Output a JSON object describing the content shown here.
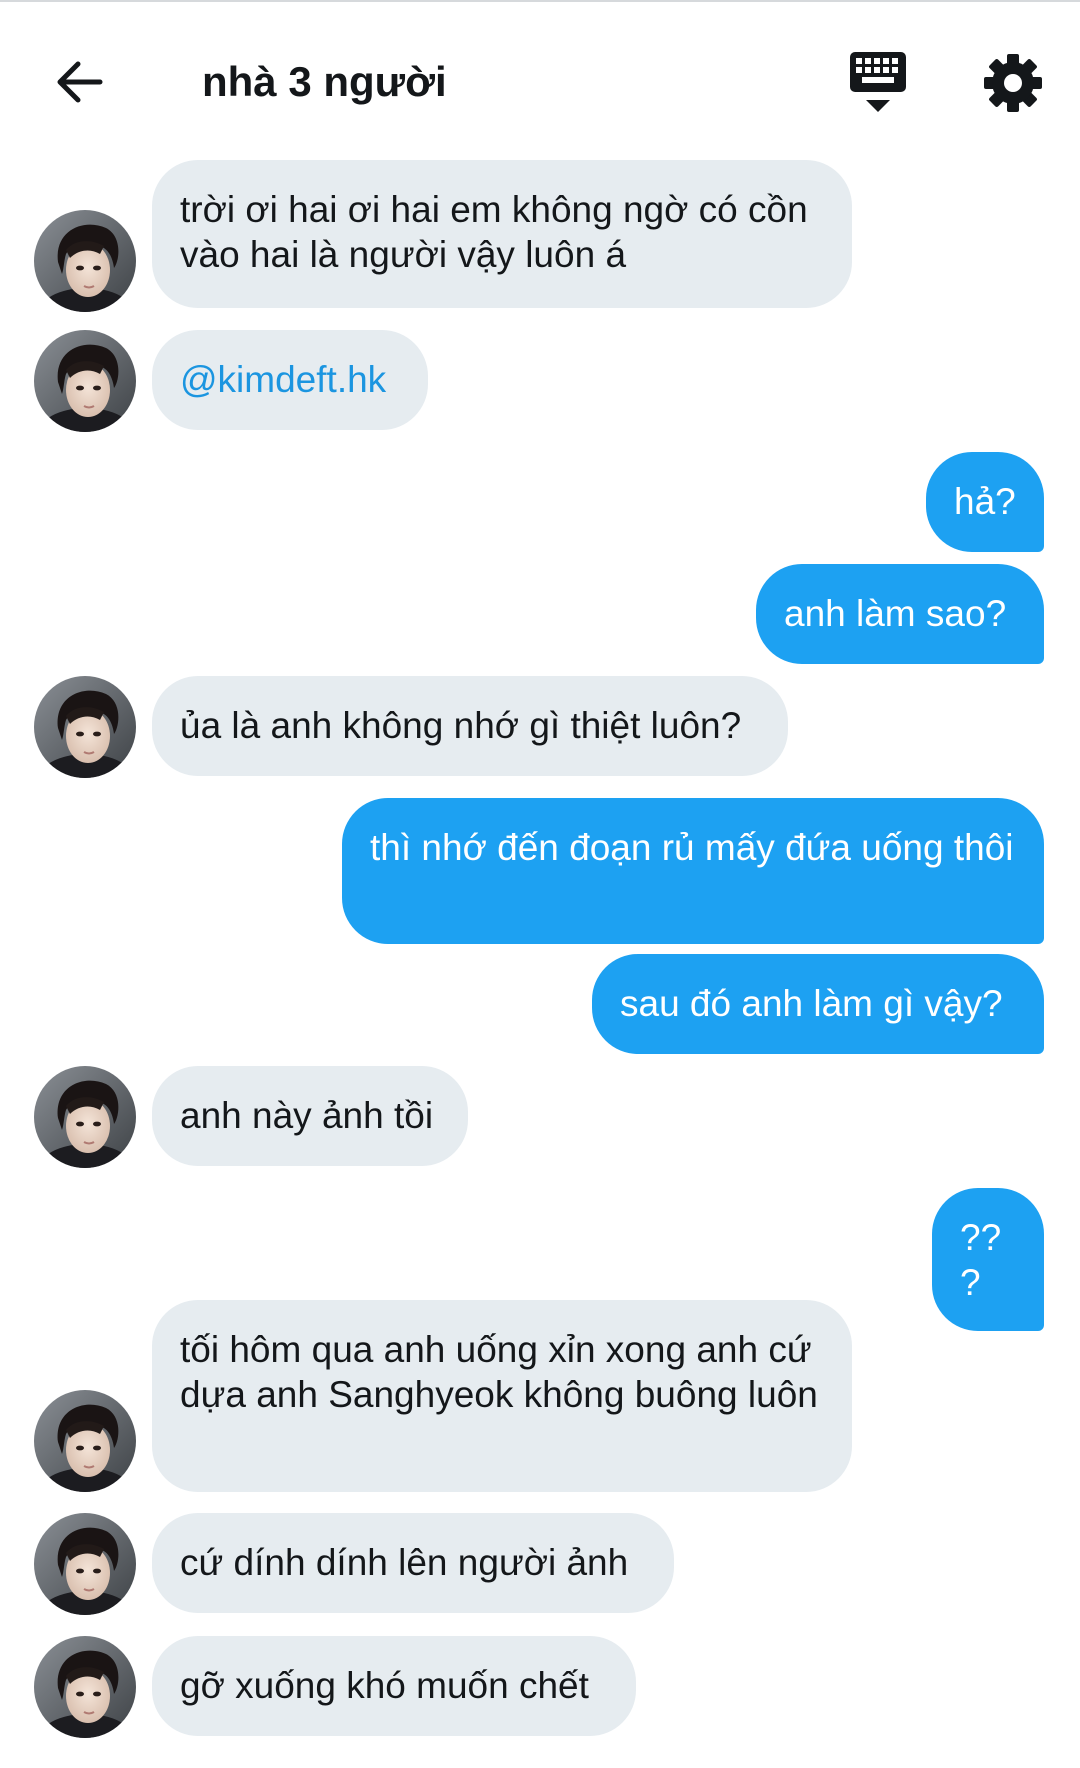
{
  "header": {
    "title": "nhà 3 người",
    "back_icon": "arrow-left-icon",
    "keyboard_icon": "keyboard-icon",
    "settings_icon": "gear-icon"
  },
  "colors": {
    "incoming_bubble": "#e6ecf0",
    "outgoing_bubble": "#1da1f2",
    "mention": "#1b95e0"
  },
  "messages": [
    {
      "side": "in",
      "text": "trời ơi hai ơi hai em không ngờ có cồn vào hai là người vậy luôn á"
    },
    {
      "side": "in",
      "text": "@kimdeft.hk",
      "mention": true
    },
    {
      "side": "out",
      "text": "hả?"
    },
    {
      "side": "out",
      "text": "anh làm sao?"
    },
    {
      "side": "in",
      "text": "ủa là anh không nhớ gì thiệt luôn?"
    },
    {
      "side": "out",
      "text": "thì nhớ đến đoạn rủ mấy đứa uống thôi"
    },
    {
      "side": "out",
      "text": "sau đó anh làm gì vậy?"
    },
    {
      "side": "in",
      "text": "anh này ảnh tồi"
    },
    {
      "side": "out",
      "text": "???"
    },
    {
      "side": "in",
      "text": "tối hôm qua anh uống xỉn xong anh cứ dựa anh Sanghyeok không buông luôn"
    },
    {
      "side": "in",
      "text": "cứ dính dính lên người ảnh"
    },
    {
      "side": "in",
      "text": "gỡ xuống khó muốn chết"
    }
  ]
}
